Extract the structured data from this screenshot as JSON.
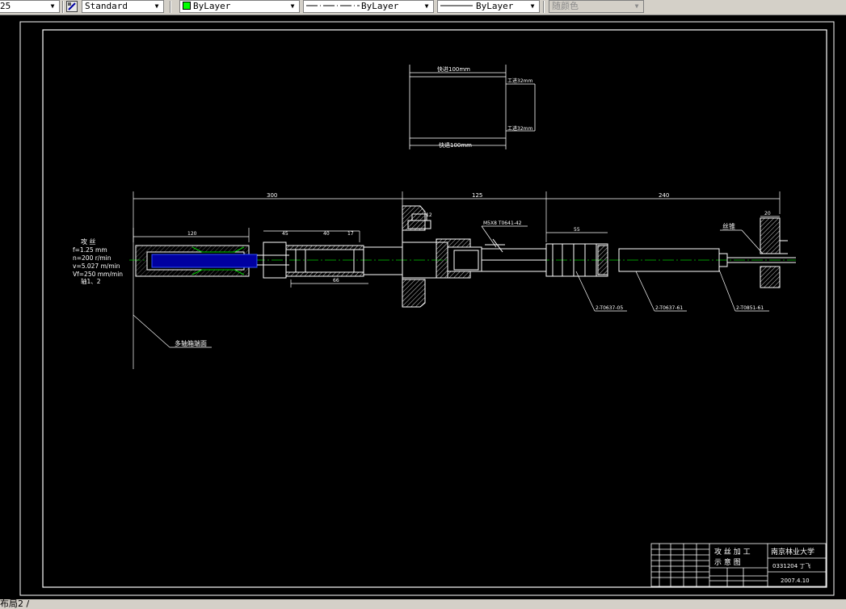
{
  "toolbar": {
    "linetype_scale": "25",
    "text_style": "Standard",
    "layer": "ByLayer",
    "linetype": "ByLayer",
    "lineweight": "ByLayer",
    "plot_style": "随颜色"
  },
  "drawing": {
    "cycle": {
      "rapid_in": "快进100mm",
      "work_in_1": "工进32mm",
      "work_in_2": "工进32mm",
      "rapid_out": "快退100mm"
    },
    "dims": {
      "d300": "300",
      "d125": "125",
      "d240": "240",
      "d120": "120",
      "d45": "45",
      "d40": "40",
      "d17": "17",
      "d66": "66",
      "d55": "55",
      "d20": "20",
      "d12": "12"
    },
    "params": {
      "title": "攻 丝",
      "feed": "f=1.25 mm",
      "speed": "n=200 r/min",
      "velocity": "v=5.027 m/min",
      "feed_rate": "Vf=250 mm/min",
      "axes": "轴1、2"
    },
    "labels": {
      "spindle_box_end": "多轴箱端面",
      "tap": "丝锥",
      "part_top": "M5X8  T0641-42",
      "part_1": "2-T0637-05",
      "part_2": "2-T0637-61",
      "part_3": "2-T0851-61"
    },
    "title_block": {
      "drawing_title_1": "攻 丝 加 工",
      "drawing_title_2": "示 意 图",
      "school": "南京林业大学",
      "author": "0331204  丁飞",
      "date": "2007.4.10"
    }
  },
  "statusbar": {
    "layout_tab": "布局2"
  }
}
